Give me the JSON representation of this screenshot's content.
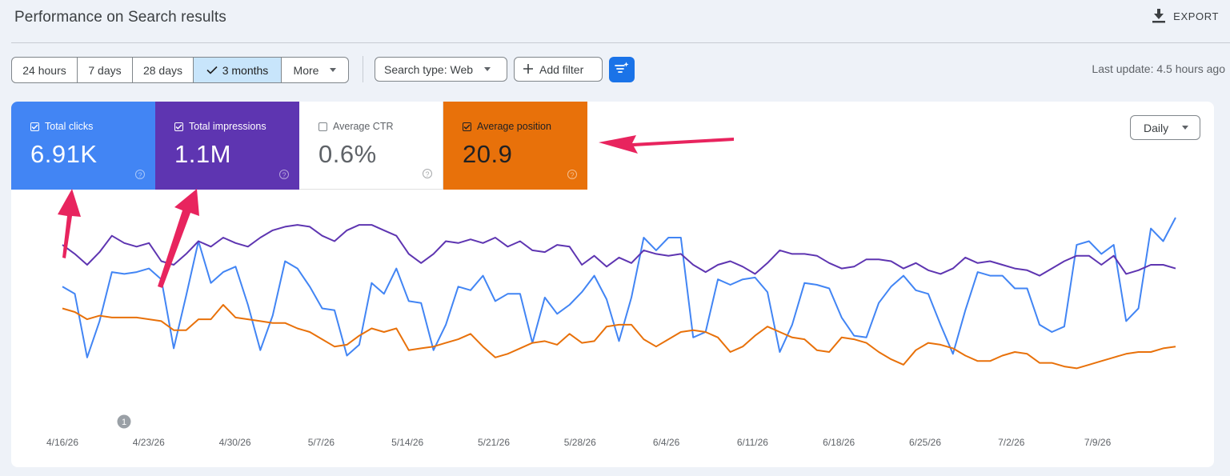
{
  "header": {
    "title": "Performance on Search results",
    "export_label": "EXPORT"
  },
  "toolbar": {
    "ranges": [
      {
        "label": "24 hours",
        "active": false
      },
      {
        "label": "7 days",
        "active": false
      },
      {
        "label": "28 days",
        "active": false
      },
      {
        "label": "3 months",
        "active": true
      },
      {
        "label": "More",
        "active": false
      }
    ],
    "search_type": "Search type: Web",
    "add_filter": "Add filter",
    "last_update": "Last update: 4.5 hours ago"
  },
  "metrics": {
    "clicks": {
      "label": "Total clicks",
      "value": "6.91K",
      "checked": true,
      "color": "#4285f4"
    },
    "impressions": {
      "label": "Total impressions",
      "value": "1.1M",
      "checked": true,
      "color": "#5e35b1"
    },
    "ctr": {
      "label": "Average CTR",
      "value": "0.6%",
      "checked": false
    },
    "position": {
      "label": "Average position",
      "value": "20.9",
      "checked": true,
      "color": "#e8710a"
    }
  },
  "granularity": "Daily",
  "annotation_marker": "1",
  "chart_data": {
    "type": "line",
    "x_tick_labels": [
      "4/16/26",
      "4/23/26",
      "4/30/26",
      "5/7/26",
      "5/14/26",
      "5/21/26",
      "5/28/26",
      "6/4/26",
      "6/11/26",
      "6/18/26",
      "6/25/26",
      "7/2/26",
      "7/9/26"
    ],
    "grid": false,
    "legend": "none",
    "series": [
      {
        "name": "Total clicks",
        "color": "#4285f4",
        "values": [
          0.62,
          0.58,
          0.23,
          0.43,
          0.7,
          0.69,
          0.7,
          0.72,
          0.66,
          0.28,
          0.57,
          0.87,
          0.64,
          0.7,
          0.73,
          0.52,
          0.27,
          0.46,
          0.76,
          0.72,
          0.62,
          0.5,
          0.49,
          0.24,
          0.3,
          0.64,
          0.58,
          0.72,
          0.54,
          0.53,
          0.27,
          0.41,
          0.62,
          0.6,
          0.68,
          0.54,
          0.58,
          0.58,
          0.31,
          0.56,
          0.47,
          0.52,
          0.59,
          0.68,
          0.55,
          0.32,
          0.56,
          0.89,
          0.82,
          0.89,
          0.89,
          0.34,
          0.37,
          0.66,
          0.63,
          0.66,
          0.67,
          0.59,
          0.26,
          0.41,
          0.64,
          0.63,
          0.61,
          0.45,
          0.35,
          0.34,
          0.53,
          0.62,
          0.68,
          0.6,
          0.58,
          0.41,
          0.25,
          0.49,
          0.7,
          0.68,
          0.68,
          0.61,
          0.61,
          0.41,
          0.37,
          0.4,
          0.85,
          0.87,
          0.8,
          0.85,
          0.43,
          0.5,
          0.94,
          0.87,
          1.0
        ]
      },
      {
        "name": "Total impressions",
        "color": "#5e35b1",
        "values": [
          0.85,
          0.8,
          0.74,
          0.81,
          0.9,
          0.86,
          0.84,
          0.86,
          0.76,
          0.74,
          0.8,
          0.87,
          0.84,
          0.89,
          0.86,
          0.84,
          0.89,
          0.93,
          0.95,
          0.96,
          0.95,
          0.9,
          0.87,
          0.93,
          0.96,
          0.96,
          0.93,
          0.9,
          0.8,
          0.75,
          0.8,
          0.87,
          0.86,
          0.88,
          0.86,
          0.89,
          0.84,
          0.87,
          0.82,
          0.81,
          0.85,
          0.84,
          0.74,
          0.79,
          0.73,
          0.78,
          0.75,
          0.82,
          0.8,
          0.79,
          0.8,
          0.74,
          0.7,
          0.74,
          0.76,
          0.73,
          0.69,
          0.75,
          0.82,
          0.8,
          0.8,
          0.79,
          0.75,
          0.72,
          0.73,
          0.77,
          0.77,
          0.76,
          0.72,
          0.75,
          0.71,
          0.69,
          0.72,
          0.78,
          0.75,
          0.76,
          0.74,
          0.72,
          0.71,
          0.68,
          0.72,
          0.76,
          0.79,
          0.79,
          0.74,
          0.79,
          0.69,
          0.71,
          0.74,
          0.74,
          0.72
        ]
      },
      {
        "name": "Average position",
        "color": "#e8710a",
        "values": [
          0.5,
          0.48,
          0.44,
          0.46,
          0.45,
          0.45,
          0.45,
          0.44,
          0.43,
          0.38,
          0.38,
          0.44,
          0.44,
          0.52,
          0.45,
          0.44,
          0.43,
          0.42,
          0.42,
          0.39,
          0.37,
          0.33,
          0.29,
          0.3,
          0.35,
          0.39,
          0.37,
          0.39,
          0.27,
          0.28,
          0.29,
          0.31,
          0.33,
          0.36,
          0.29,
          0.23,
          0.25,
          0.28,
          0.31,
          0.32,
          0.3,
          0.36,
          0.31,
          0.32,
          0.4,
          0.41,
          0.41,
          0.33,
          0.29,
          0.33,
          0.37,
          0.38,
          0.37,
          0.34,
          0.26,
          0.29,
          0.35,
          0.4,
          0.37,
          0.34,
          0.33,
          0.27,
          0.26,
          0.34,
          0.33,
          0.31,
          0.26,
          0.22,
          0.19,
          0.27,
          0.31,
          0.3,
          0.28,
          0.24,
          0.21,
          0.21,
          0.24,
          0.26,
          0.25,
          0.2,
          0.2,
          0.18,
          0.17,
          0.19,
          0.21,
          0.23,
          0.25,
          0.26,
          0.26,
          0.28,
          0.29
        ]
      }
    ]
  }
}
